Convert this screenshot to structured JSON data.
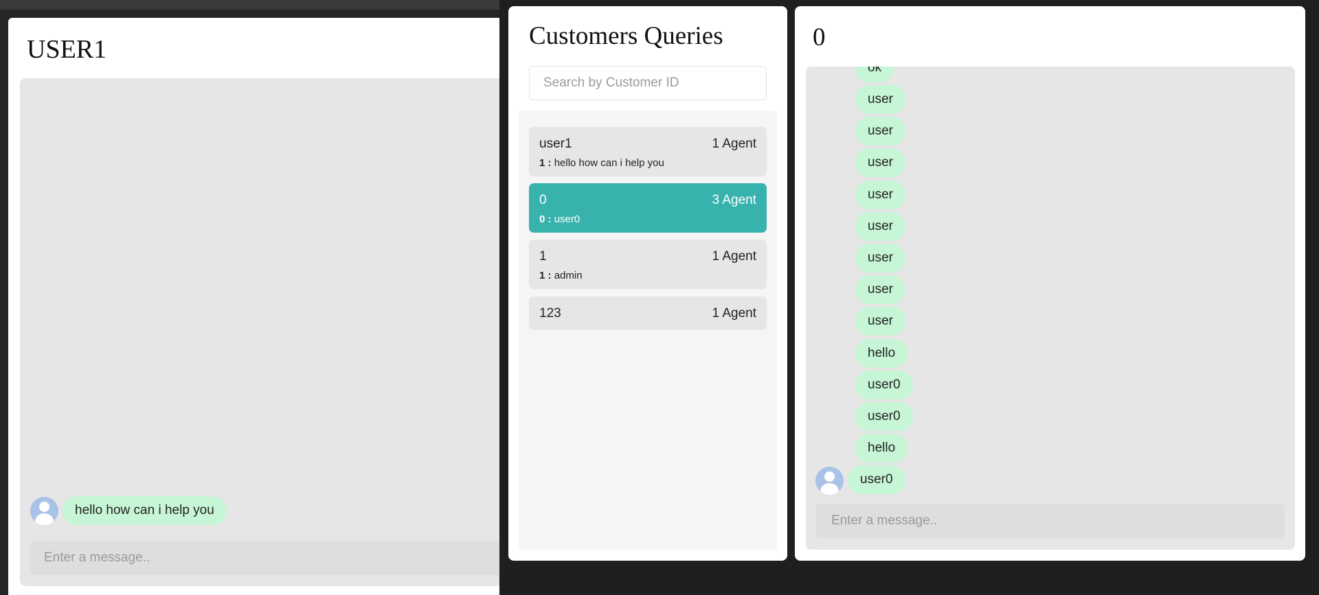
{
  "user_window": {
    "title": "USER1",
    "messages": [
      {
        "text": "hello how can i help you"
      }
    ],
    "input_placeholder": "Enter a message.."
  },
  "queries": {
    "title": "Customers Queries",
    "search_placeholder": "Search by Customer ID",
    "items": [
      {
        "id": "user1",
        "agents": "1 Agent",
        "sender": "1 :",
        "preview": "hello how can i help you",
        "active": false
      },
      {
        "id": "0",
        "agents": "3 Agent",
        "sender": "0 :",
        "preview": "user0",
        "active": true
      },
      {
        "id": "1",
        "agents": "1 Agent",
        "sender": "1 :",
        "preview": "admin",
        "active": false
      },
      {
        "id": "123",
        "agents": "1 Agent",
        "sender": "",
        "preview": "",
        "active": false
      }
    ]
  },
  "conversation": {
    "title": "0",
    "messages": [
      "ok",
      "user",
      "user",
      "user",
      "user",
      "user",
      "user",
      "user",
      "user",
      "hello",
      "user0",
      "user0",
      "hello",
      "user0"
    ],
    "input_placeholder": "Enter a message.."
  },
  "colors": {
    "accent": "#38b2ac",
    "bubble": "#c6f6d5",
    "chat_bg": "#e6e6e6"
  }
}
